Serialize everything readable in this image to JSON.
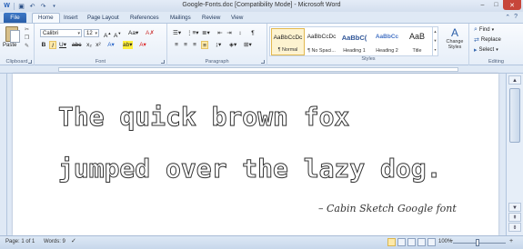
{
  "window": {
    "title": "Google-Fonts.doc [Compatibility Mode] - Microsoft Word",
    "controls": {
      "minimize": "–",
      "maximize": "□",
      "close": "✕"
    }
  },
  "qat": {
    "save_icon": "save-icon",
    "undo_icon": "undo-icon",
    "redo_icon": "redo-icon"
  },
  "tabs": [
    {
      "label": "File"
    },
    {
      "label": "Home"
    },
    {
      "label": "Insert"
    },
    {
      "label": "Page Layout"
    },
    {
      "label": "References"
    },
    {
      "label": "Mailings"
    },
    {
      "label": "Review"
    },
    {
      "label": "View"
    }
  ],
  "ribbon": {
    "clipboard": {
      "paste_label": "Paste",
      "group_label": "Clipboard"
    },
    "font": {
      "font_name": "Calibri",
      "font_size": "12",
      "group_label": "Font"
    },
    "paragraph": {
      "group_label": "Paragraph"
    },
    "styles": {
      "group_label": "Styles",
      "items": [
        {
          "preview": "AaBbCcDc",
          "label": "¶ Normal"
        },
        {
          "preview": "AaBbCcDc",
          "label": "¶ No Spaci..."
        },
        {
          "preview": "AaBbC(",
          "label": "Heading 1"
        },
        {
          "preview": "AaBbCc",
          "label": "Heading 2"
        },
        {
          "preview": "AaB",
          "label": "Title"
        }
      ],
      "change_styles_label": "Change Styles"
    },
    "editing": {
      "find_label": "Find",
      "replace_label": "Replace",
      "select_label": "Select",
      "group_label": "Editing"
    }
  },
  "document": {
    "line1": "The quick brown fox",
    "line2": "jumped over the lazy dog.",
    "caption": "– Cabin Sketch Google font"
  },
  "status": {
    "page": "Page: 1 of 1",
    "words": "Words: 9",
    "zoom": "100%"
  },
  "colors": {
    "file_tab": "#2a5ea8",
    "close_button": "#c7463a",
    "selected_style": "#fdf3d0"
  }
}
